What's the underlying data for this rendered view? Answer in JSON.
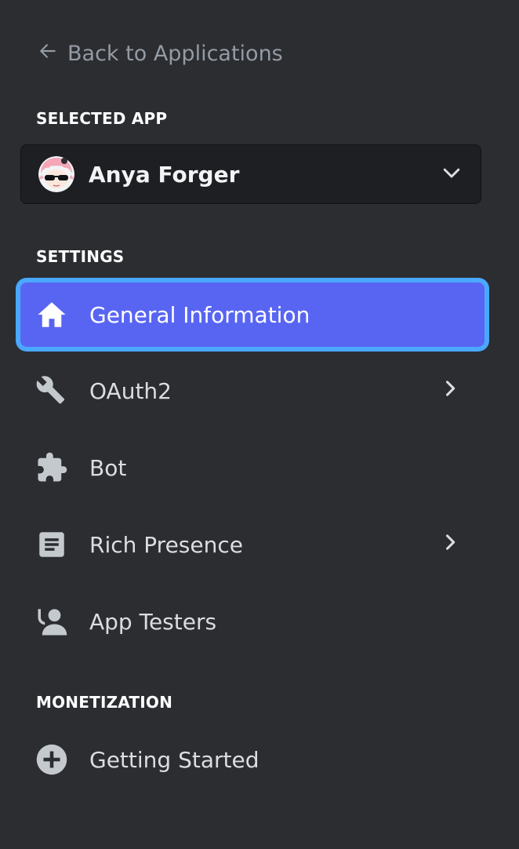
{
  "back_link": {
    "label": "Back to Applications"
  },
  "selected_app": {
    "section_label": "SELECTED APP",
    "app_name": "Anya Forger"
  },
  "settings": {
    "section_label": "SETTINGS",
    "items": [
      {
        "label": "General Information",
        "icon": "home-icon",
        "active": true,
        "has_submenu": false
      },
      {
        "label": "OAuth2",
        "icon": "wrench-icon",
        "active": false,
        "has_submenu": true
      },
      {
        "label": "Bot",
        "icon": "puzzle-piece-icon",
        "active": false,
        "has_submenu": false
      },
      {
        "label": "Rich Presence",
        "icon": "document-icon",
        "active": false,
        "has_submenu": true
      },
      {
        "label": "App Testers",
        "icon": "user-add-icon",
        "active": false,
        "has_submenu": false
      }
    ]
  },
  "monetization": {
    "section_label": "MONETIZATION",
    "items": [
      {
        "label": "Getting Started",
        "icon": "plus-circle-icon",
        "active": false,
        "has_submenu": false
      }
    ]
  },
  "colors": {
    "background": "#2b2d31",
    "active_item": "#5865f2",
    "focus_ring": "#4aa8ff",
    "muted_text": "#949ba4",
    "select_background": "#1e1f22"
  }
}
